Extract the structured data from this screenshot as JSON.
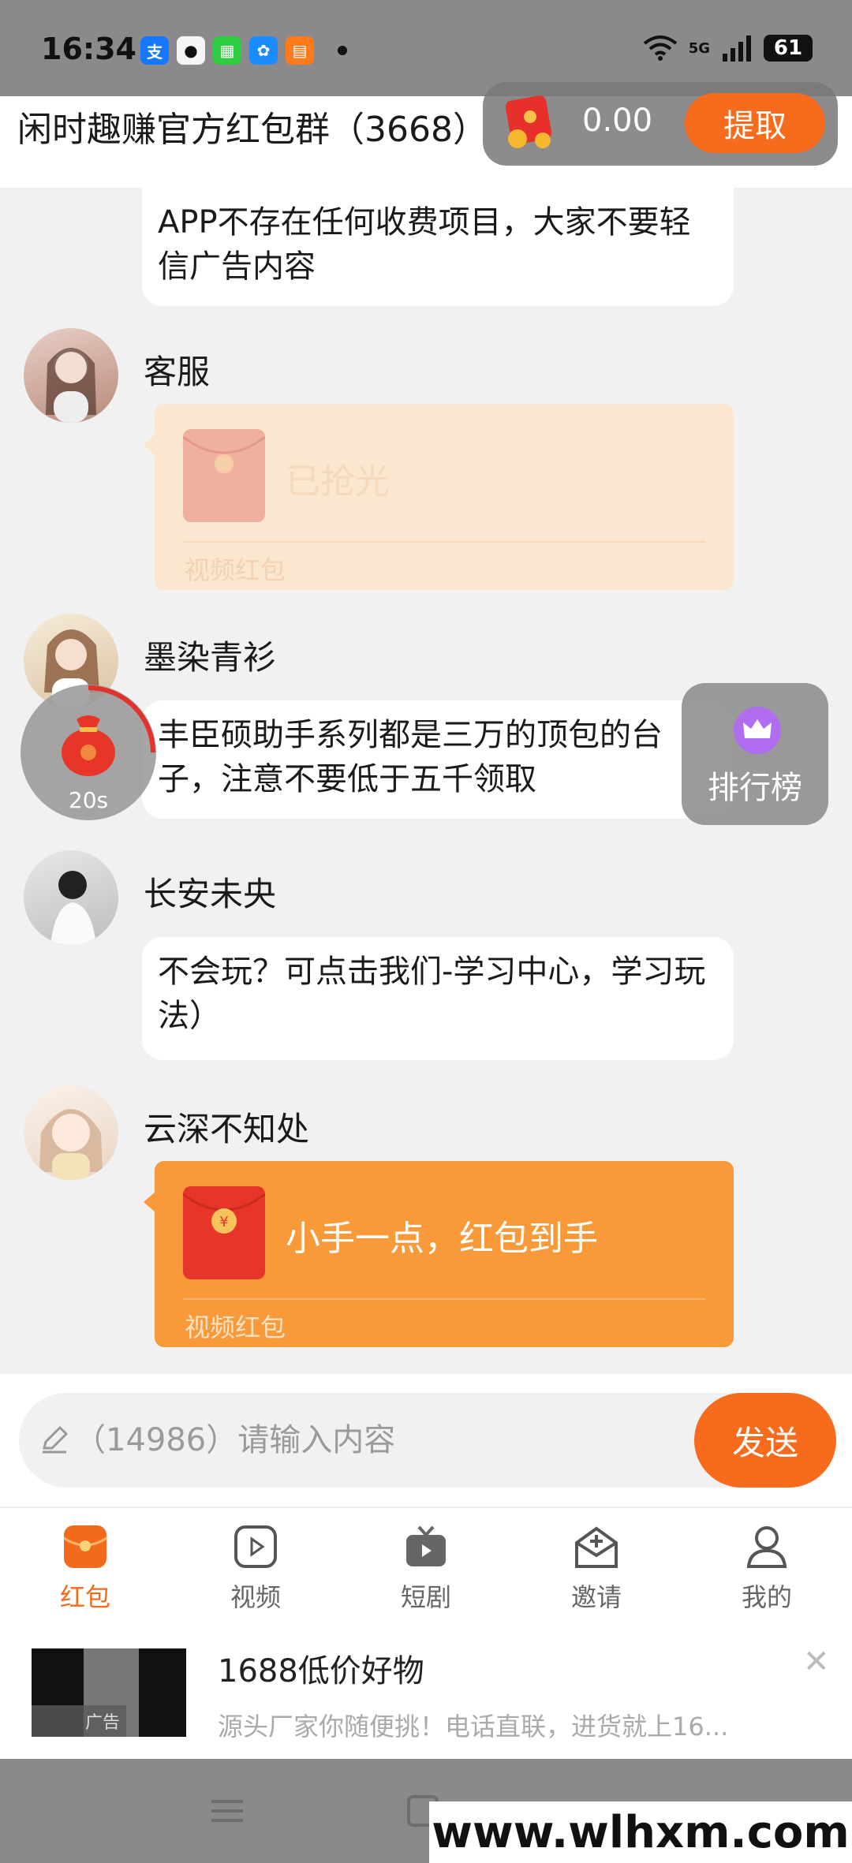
{
  "status_bar": {
    "time": "16:34",
    "network": "5G",
    "battery": "61"
  },
  "header": {
    "title": "闲时趣赚官方红包群（3668）",
    "balance": "0.00",
    "withdraw_label": "提取"
  },
  "messages": [
    {
      "text": "APP不存在任何收费项目，大家不要轻信广告内容"
    },
    {
      "sender": "客服",
      "envelope_text": "已抢光",
      "envelope_type": "视频红包"
    },
    {
      "sender": "墨染青衫",
      "text": "丰臣硕助手系列都是三万的顶包的台子，注意不要低于五千领取"
    },
    {
      "sender": "长安未央",
      "text": "不会玩？可点击我们-学习中心，学习玩法）"
    },
    {
      "sender": "云深不知处",
      "envelope_text": "小手一点，红包到手",
      "envelope_type": "视频红包"
    }
  ],
  "floating": {
    "timer": "20s",
    "rank_label": "排行榜"
  },
  "input": {
    "placeholder": "（14986）请输入内容",
    "send_label": "发送"
  },
  "tabs": [
    {
      "label": "红包",
      "icon": "red-packet-icon",
      "active": true
    },
    {
      "label": "视频",
      "icon": "video-icon"
    },
    {
      "label": "短剧",
      "icon": "tv-icon"
    },
    {
      "label": "邀请",
      "icon": "invite-icon"
    },
    {
      "label": "我的",
      "icon": "profile-icon"
    }
  ],
  "ad": {
    "badge": "广告",
    "title": "1688低价好物",
    "description": "源头厂家你随便挑！电话直联，进货就上16..."
  },
  "watermark": "www.wlhxm.com",
  "colors": {
    "accent": "#f76b1c",
    "tab_active": "#f26b1d",
    "envelope_active": "#f89a3a",
    "envelope_faded": "#fbe6cf"
  }
}
